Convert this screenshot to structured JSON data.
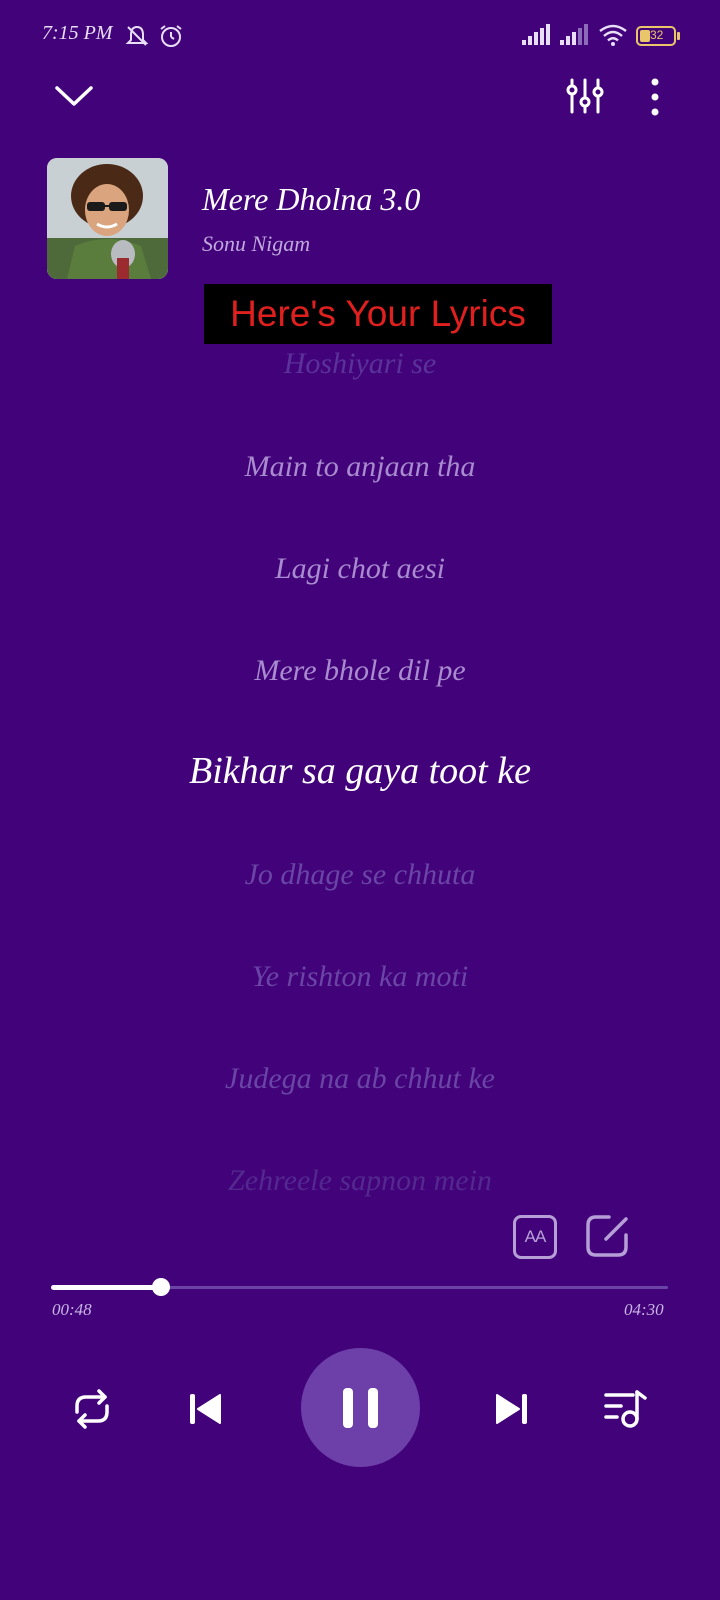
{
  "status_bar": {
    "time": "7:15 PM",
    "battery": "32",
    "icons": [
      "notifications-off-icon",
      "alarm-icon",
      "signal-icon",
      "signal-icon",
      "wifi-icon",
      "battery-icon"
    ]
  },
  "toolbar": {
    "icons": [
      "chevron-down-icon",
      "equalizer-icon",
      "more-vertical-icon"
    ]
  },
  "song": {
    "title": "Mere Dholna 3.0",
    "artist": "Sonu Nigam"
  },
  "banner": {
    "text": "Here's Your Lyrics"
  },
  "lyrics": [
    {
      "text": "Hoshiyari se"
    },
    {
      "text": "Main to anjaan tha"
    },
    {
      "text": "Lagi chot aesi"
    },
    {
      "text": "Mere bhole dil pe"
    },
    {
      "text": "Bikhar sa gaya toot ke",
      "active": true
    },
    {
      "text": "Jo dhage se chhuta"
    },
    {
      "text": "Ye rishton ka moti"
    },
    {
      "text": "Judega na ab chhut ke"
    },
    {
      "text": "Zehreele sapnon mein"
    }
  ],
  "lyric_tools": {
    "font_size_label": "AA",
    "icons": [
      "text-size-icon",
      "edit-icon"
    ]
  },
  "progress": {
    "elapsed": "00:48",
    "duration": "04:30",
    "fraction": 0.178
  },
  "controls": {
    "icons": [
      "repeat-icon",
      "previous-icon",
      "pause-icon",
      "next-icon",
      "playlist-icon"
    ]
  },
  "colors": {
    "background": "#42037a",
    "active_lyric": "#ffffff",
    "inactive_lyric": "#a98bd0",
    "banner_text": "#e0201f",
    "banner_background": "#000000"
  }
}
